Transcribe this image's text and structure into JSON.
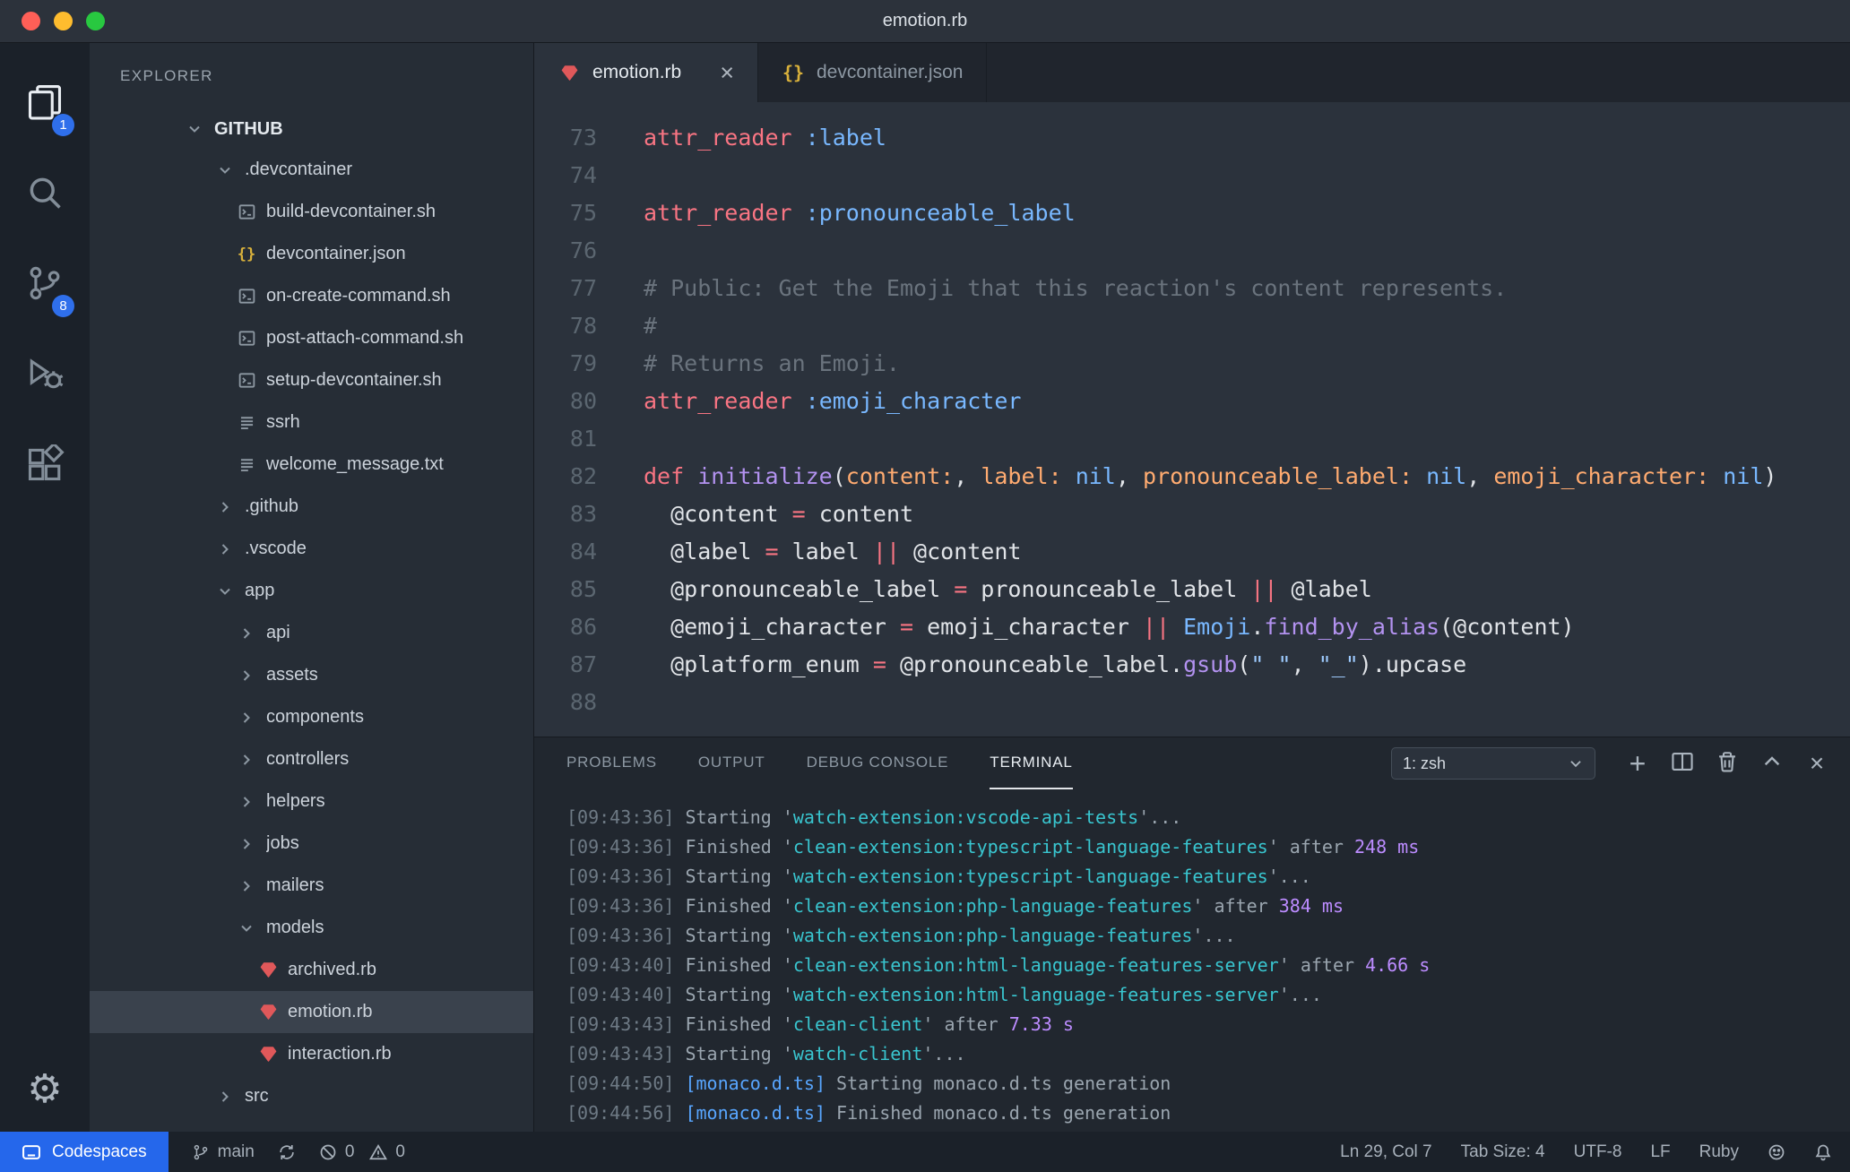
{
  "window": {
    "title": "emotion.rb"
  },
  "activity_bar": {
    "explorer_badge": "1",
    "source_control_badge": "8"
  },
  "sidebar": {
    "header": "EXPLORER",
    "root_label": "GITHUB",
    "tree": [
      {
        "label": ".devcontainer",
        "kind": "folder",
        "level": 1,
        "expanded": true
      },
      {
        "label": "build-devcontainer.sh",
        "kind": "file",
        "icon": "shell",
        "level": 2
      },
      {
        "label": "devcontainer.json",
        "kind": "file",
        "icon": "json",
        "level": 2
      },
      {
        "label": "on-create-command.sh",
        "kind": "file",
        "icon": "shell",
        "level": 2
      },
      {
        "label": "post-attach-command.sh",
        "kind": "file",
        "icon": "shell",
        "level": 2
      },
      {
        "label": "setup-devcontainer.sh",
        "kind": "file",
        "icon": "shell",
        "level": 2
      },
      {
        "label": "ssrh",
        "kind": "file",
        "icon": "text",
        "level": 2
      },
      {
        "label": "welcome_message.txt",
        "kind": "file",
        "icon": "text",
        "level": 2
      },
      {
        "label": ".github",
        "kind": "folder",
        "level": 1,
        "expanded": false
      },
      {
        "label": ".vscode",
        "kind": "folder",
        "level": 1,
        "expanded": false
      },
      {
        "label": "app",
        "kind": "folder",
        "level": 1,
        "expanded": true
      },
      {
        "label": "api",
        "kind": "folder",
        "level": 2,
        "expanded": false
      },
      {
        "label": "assets",
        "kind": "folder",
        "level": 2,
        "expanded": false
      },
      {
        "label": "components",
        "kind": "folder",
        "level": 2,
        "expanded": false
      },
      {
        "label": "controllers",
        "kind": "folder",
        "level": 2,
        "expanded": false
      },
      {
        "label": "helpers",
        "kind": "folder",
        "level": 2,
        "expanded": false
      },
      {
        "label": "jobs",
        "kind": "folder",
        "level": 2,
        "expanded": false
      },
      {
        "label": "mailers",
        "kind": "folder",
        "level": 2,
        "expanded": false
      },
      {
        "label": "models",
        "kind": "folder",
        "level": 2,
        "expanded": true
      },
      {
        "label": "archived.rb",
        "kind": "file",
        "icon": "ruby",
        "level": 3
      },
      {
        "label": "emotion.rb",
        "kind": "file",
        "icon": "ruby",
        "level": 3,
        "selected": true
      },
      {
        "label": "interaction.rb",
        "kind": "file",
        "icon": "ruby",
        "level": 3
      },
      {
        "label": "src",
        "kind": "folder",
        "level": 1,
        "expanded": false
      }
    ]
  },
  "editor": {
    "tabs": [
      {
        "label": "emotion.rb",
        "icon": "ruby",
        "active": true
      },
      {
        "label": "devcontainer.json",
        "icon": "json",
        "active": false
      }
    ],
    "token_colors": {
      "k": "#f97583",
      "s": "#79b8ff",
      "c": "#6a737d",
      "f": "#e1e4e8",
      "p": "#b392f0",
      "o": "#ffab70",
      "str": "#9ecbff"
    },
    "lines": [
      {
        "n": 73,
        "segs": [
          [
            "k",
            "attr_reader"
          ],
          [
            "f",
            " "
          ],
          [
            "s",
            ":label"
          ]
        ]
      },
      {
        "n": 74,
        "segs": []
      },
      {
        "n": 75,
        "segs": [
          [
            "k",
            "attr_reader"
          ],
          [
            "f",
            " "
          ],
          [
            "s",
            ":pronounceable_label"
          ]
        ]
      },
      {
        "n": 76,
        "segs": []
      },
      {
        "n": 77,
        "segs": [
          [
            "c",
            "# Public: Get the Emoji that this reaction's content represents."
          ]
        ]
      },
      {
        "n": 78,
        "segs": [
          [
            "c",
            "#"
          ]
        ]
      },
      {
        "n": 79,
        "segs": [
          [
            "c",
            "# Returns an Emoji."
          ]
        ]
      },
      {
        "n": 80,
        "segs": [
          [
            "k",
            "attr_reader"
          ],
          [
            "f",
            " "
          ],
          [
            "s",
            ":emoji_character"
          ]
        ]
      },
      {
        "n": 81,
        "segs": []
      },
      {
        "n": 82,
        "segs": [
          [
            "k",
            "def"
          ],
          [
            "f",
            " "
          ],
          [
            "p",
            "initialize"
          ],
          [
            "f",
            "("
          ],
          [
            "o",
            "content:"
          ],
          [
            "f",
            ", "
          ],
          [
            "o",
            "label:"
          ],
          [
            "f",
            " "
          ],
          [
            "s",
            "nil"
          ],
          [
            "f",
            ", "
          ],
          [
            "o",
            "pronounceable_label:"
          ],
          [
            "f",
            " "
          ],
          [
            "s",
            "nil"
          ],
          [
            "f",
            ", "
          ],
          [
            "o",
            "emoji_character:"
          ],
          [
            "f",
            " "
          ],
          [
            "s",
            "nil"
          ],
          [
            "f",
            ")"
          ]
        ]
      },
      {
        "n": 83,
        "segs": [
          [
            "f",
            "  @content "
          ],
          [
            "k",
            "="
          ],
          [
            "f",
            " content"
          ]
        ]
      },
      {
        "n": 84,
        "segs": [
          [
            "f",
            "  @label "
          ],
          [
            "k",
            "="
          ],
          [
            "f",
            " label "
          ],
          [
            "k",
            "||"
          ],
          [
            "f",
            " @content"
          ]
        ]
      },
      {
        "n": 85,
        "segs": [
          [
            "f",
            "  @pronounceable_label "
          ],
          [
            "k",
            "="
          ],
          [
            "f",
            " pronounceable_label "
          ],
          [
            "k",
            "||"
          ],
          [
            "f",
            " @label"
          ]
        ]
      },
      {
        "n": 86,
        "segs": [
          [
            "f",
            "  @emoji_character "
          ],
          [
            "k",
            "="
          ],
          [
            "f",
            " emoji_character "
          ],
          [
            "k",
            "||"
          ],
          [
            "f",
            " "
          ],
          [
            "s",
            "Emoji"
          ],
          [
            "f",
            "."
          ],
          [
            "p",
            "find_by_alias"
          ],
          [
            "f",
            "(@content)"
          ]
        ]
      },
      {
        "n": 87,
        "segs": [
          [
            "f",
            "  @platform_enum "
          ],
          [
            "k",
            "="
          ],
          [
            "f",
            " @pronounceable_label."
          ],
          [
            "p",
            "gsub"
          ],
          [
            "f",
            "("
          ],
          [
            "str",
            "\" \""
          ],
          [
            "f",
            ", "
          ],
          [
            "str",
            "\"_\""
          ],
          [
            "f",
            ").upcase"
          ]
        ]
      },
      {
        "n": 88,
        "segs": []
      }
    ]
  },
  "panel": {
    "tabs": [
      {
        "label": "PROBLEMS",
        "active": false
      },
      {
        "label": "OUTPUT",
        "active": false
      },
      {
        "label": "DEBUG CONSOLE",
        "active": false
      },
      {
        "label": "TERMINAL",
        "active": true
      }
    ],
    "shell_selector": "1: zsh",
    "token_colors": {
      "ts": "#6e7a85",
      "body": "#9aa5af",
      "task": "#39c5cf",
      "dur": "#bc8cff",
      "file": "#58a6ff"
    },
    "lines": [
      {
        "segs": [
          [
            "ts",
            "[09:43:36]"
          ],
          [
            "body",
            " Starting '"
          ],
          [
            "task",
            "watch-extension:vscode-api-tests"
          ],
          [
            "body",
            "'..."
          ]
        ]
      },
      {
        "segs": [
          [
            "ts",
            "[09:43:36]"
          ],
          [
            "body",
            " Finished '"
          ],
          [
            "task",
            "clean-extension:typescript-language-features"
          ],
          [
            "body",
            "' after "
          ],
          [
            "dur",
            "248 ms"
          ]
        ]
      },
      {
        "segs": [
          [
            "ts",
            "[09:43:36]"
          ],
          [
            "body",
            " Starting '"
          ],
          [
            "task",
            "watch-extension:typescript-language-features"
          ],
          [
            "body",
            "'..."
          ]
        ]
      },
      {
        "segs": [
          [
            "ts",
            "[09:43:36]"
          ],
          [
            "body",
            " Finished '"
          ],
          [
            "task",
            "clean-extension:php-language-features"
          ],
          [
            "body",
            "' after "
          ],
          [
            "dur",
            "384 ms"
          ]
        ]
      },
      {
        "segs": [
          [
            "ts",
            "[09:43:36]"
          ],
          [
            "body",
            " Starting '"
          ],
          [
            "task",
            "watch-extension:php-language-features"
          ],
          [
            "body",
            "'..."
          ]
        ]
      },
      {
        "segs": [
          [
            "ts",
            "[09:43:40]"
          ],
          [
            "body",
            " Finished '"
          ],
          [
            "task",
            "clean-extension:html-language-features-server"
          ],
          [
            "body",
            "' after "
          ],
          [
            "dur",
            "4.66 s"
          ]
        ]
      },
      {
        "segs": [
          [
            "ts",
            "[09:43:40]"
          ],
          [
            "body",
            " Starting '"
          ],
          [
            "task",
            "watch-extension:html-language-features-server"
          ],
          [
            "body",
            "'..."
          ]
        ]
      },
      {
        "segs": [
          [
            "ts",
            "[09:43:43]"
          ],
          [
            "body",
            " Finished '"
          ],
          [
            "task",
            "clean-client"
          ],
          [
            "body",
            "' after "
          ],
          [
            "dur",
            "7.33 s"
          ]
        ]
      },
      {
        "segs": [
          [
            "ts",
            "[09:43:43]"
          ],
          [
            "body",
            " Starting '"
          ],
          [
            "task",
            "watch-client"
          ],
          [
            "body",
            "'..."
          ]
        ]
      },
      {
        "segs": [
          [
            "ts",
            "[09:44:50]"
          ],
          [
            "file",
            " [monaco.d.ts]"
          ],
          [
            "body",
            " Starting monaco.d.ts generation"
          ]
        ]
      },
      {
        "segs": [
          [
            "ts",
            "[09:44:56]"
          ],
          [
            "file",
            " [monaco.d.ts]"
          ],
          [
            "body",
            " Finished monaco.d.ts generation"
          ]
        ]
      }
    ]
  },
  "status_bar": {
    "remote_label": "Codespaces",
    "branch": "main",
    "errors": "0",
    "warnings": "0",
    "right_items": [
      "Ln 29, Col 7",
      "Tab Size: 4",
      "UTF-8",
      "LF",
      "Ruby"
    ]
  }
}
